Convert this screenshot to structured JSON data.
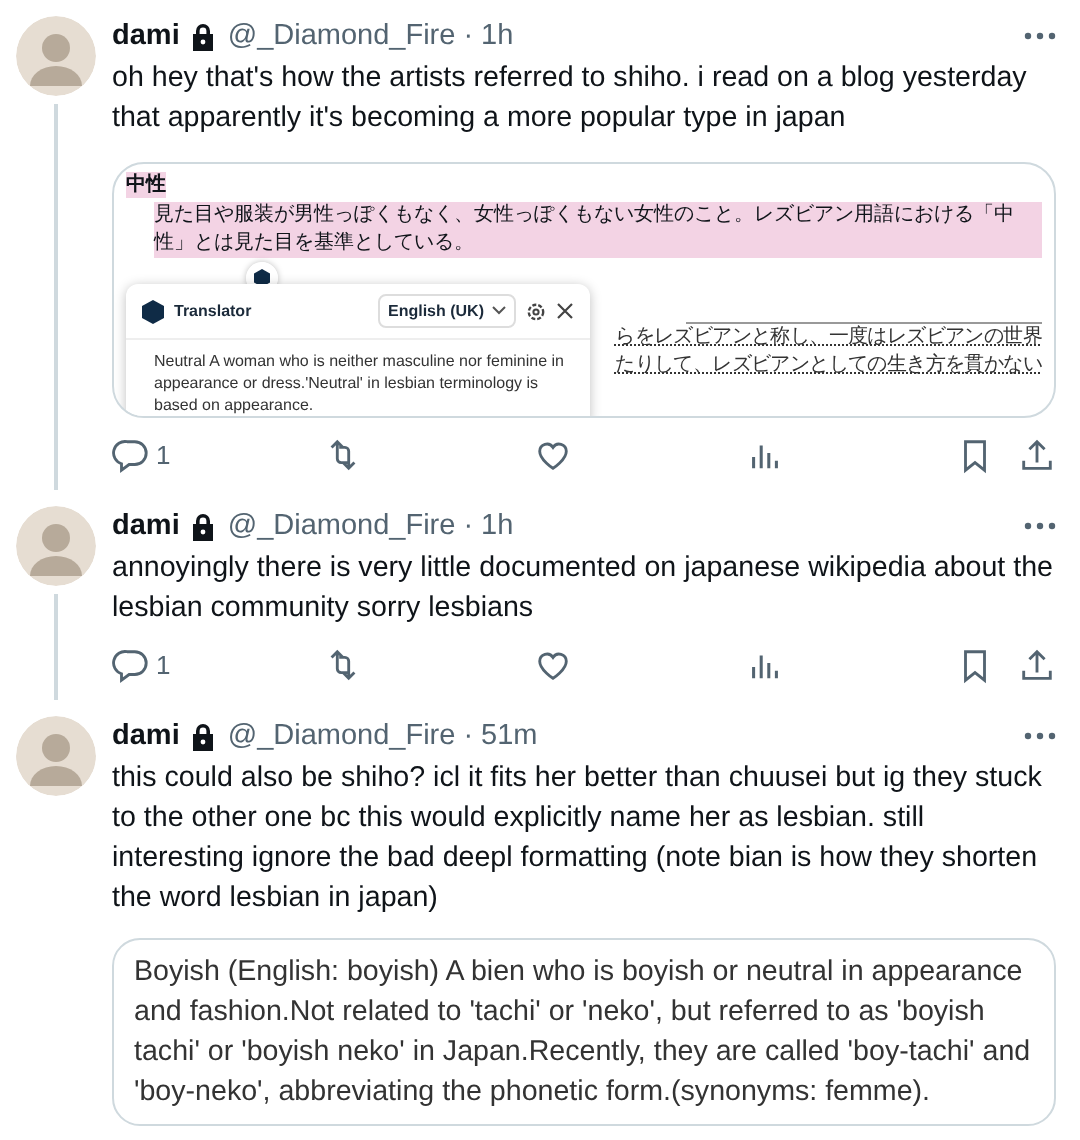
{
  "tweets": [
    {
      "name": "dami",
      "protected": true,
      "handle": "@_Diamond_Fire",
      "dot": "·",
      "time": "1h",
      "thread_continues": true,
      "text": "oh hey that's how the artists referred to shiho. i read on a blog yesterday that apparently it's becoming a more popular type in japan",
      "media": {
        "kind": "screenshot",
        "term": "中性",
        "definition": "見た目や服装が男性っぽくもなく、女性っぽくもない女性のこと。レズビアン用語における「中性」とは見た目を基準としている。",
        "side_lines": [
          "らをレズビアンと称し、一度はレズビアンの世界",
          "たりして、レズビアンとしての生き方を貫かない"
        ],
        "translator": {
          "title": "Translator",
          "language": "English (UK)",
          "translation": "Neutral A woman who is neither masculine nor feminine in appearance or dress.'Neutral' in lesbian terminology is based on appearance."
        }
      },
      "actions": {
        "replies": "1"
      }
    },
    {
      "name": "dami",
      "protected": true,
      "handle": "@_Diamond_Fire",
      "dot": "·",
      "time": "1h",
      "thread_continues": true,
      "text": "annoyingly there is very little documented on japanese wikipedia about the lesbian community sorry lesbians",
      "actions": {
        "replies": "1"
      }
    },
    {
      "name": "dami",
      "protected": true,
      "handle": "@_Diamond_Fire",
      "dot": "·",
      "time": "51m",
      "thread_continues": false,
      "text": "this could also be shiho? icl it fits her better than chuusei but ig they stuck to the other one bc this would explicitly name her as lesbian. still interesting ignore the bad deepl formatting (note bian is how they shorten the word lesbian in japan)",
      "media": {
        "kind": "text_card",
        "text": "Boyish (English: boyish) A bien who is boyish or neutral in appearance and fashion.Not related to 'tachi' or 'neko', but referred to as 'boyish tachi' or 'boyish neko' in Japan.Recently, they are called 'boy-tachi' and 'boy-neko', abbreviating the phonetic form.(synonyms: femme)."
      }
    }
  ]
}
